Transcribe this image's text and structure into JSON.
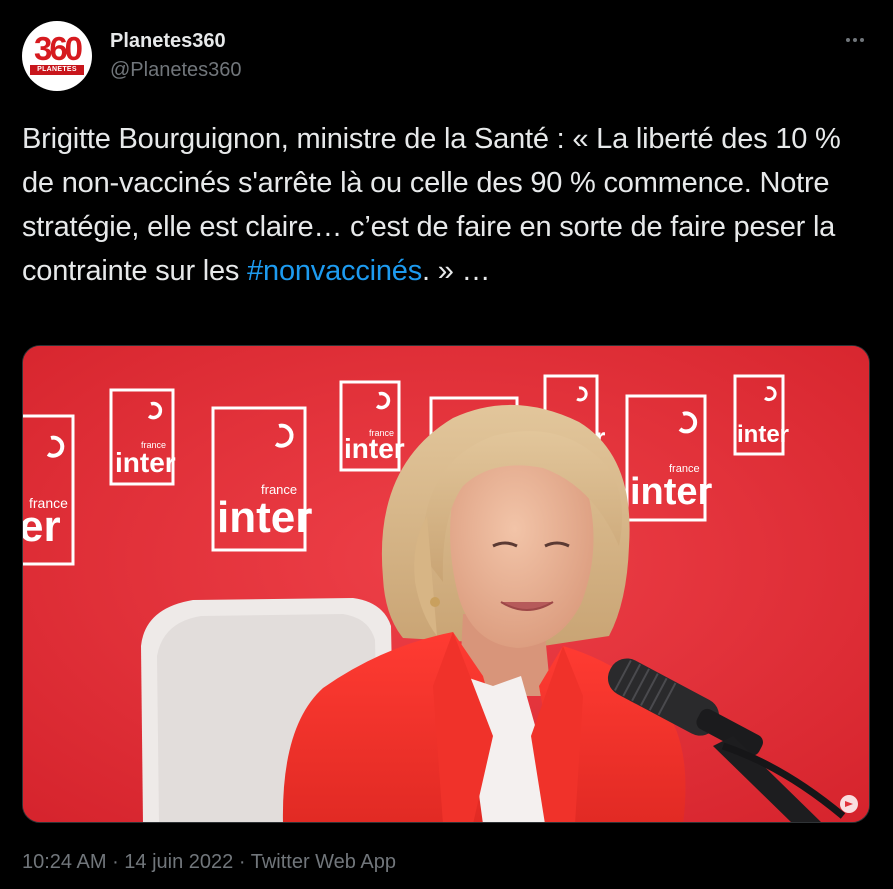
{
  "author": {
    "display_name": "Planetes360",
    "handle": "@Planetes360",
    "avatar_text": "360",
    "avatar_subtext": "PLANETES"
  },
  "menu_icon": "more-horizontal-icon",
  "tweet": {
    "text_before": "Brigitte Bourguignon, ministre de la Santé : « La liberté des 10 % de non-vaccinés s'arrête là ou celle des 90 % commence. Notre stratégie, elle est claire… c’est de faire en sorte de faire peser la contrainte sur les ",
    "hashtag": "#nonvaccinés",
    "text_after": ". » …"
  },
  "media": {
    "backdrop_logo_top": "france",
    "backdrop_logo_main": "inter",
    "backdrop_logo_partial": "er",
    "corner_icon": "gif-badge-icon"
  },
  "footer": {
    "time": "10:24 AM",
    "sep1": " · ",
    "date": "14 juin 2022",
    "sep2": " · ",
    "source": "Twitter Web App"
  },
  "colors": {
    "background": "#000000",
    "text": "#e7e9ea",
    "muted": "#71767b",
    "link": "#1d9bf0",
    "studio_red": "#e2323b"
  }
}
